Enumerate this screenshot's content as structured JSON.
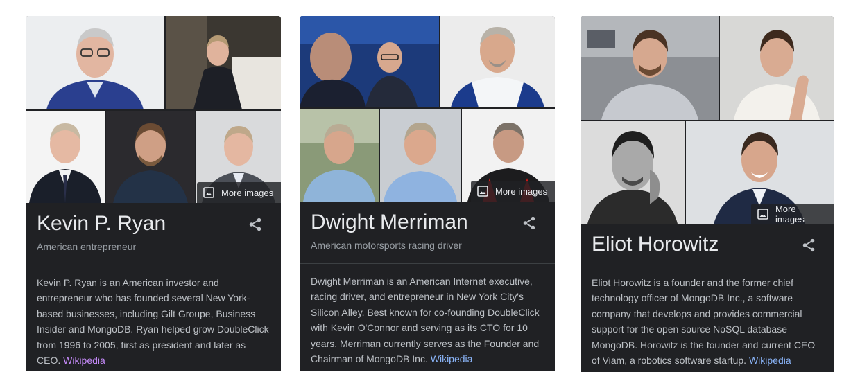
{
  "colors": {
    "card_bg": "#202124",
    "title": "#e8eaed",
    "subtitle": "#9aa0a6",
    "body": "#bdc1c6",
    "link": "#8ab4f8",
    "link_visited": "#c58af9"
  },
  "cards": [
    {
      "name": "Kevin P. Ryan",
      "subtitle": "American entrepreneur",
      "description": "Kevin P. Ryan is an American investor and entrepreneur who has founded several New York-based businesses, including Gilt Groupe, Business Insider and MongoDB. Ryan helped grow DoubleClick from 1996 to 2005, first as president and later as CEO.",
      "link": "Wikipedia",
      "more_images": "More images"
    },
    {
      "name": "Dwight Merriman",
      "subtitle": "American motorsports racing driver",
      "description": "Dwight Merriman is an American Internet executive, racing driver, and entrepreneur in New York City's Silicon Alley. Best known for co-founding DoubleClick with Kevin O'Connor and serving as its CTO for 10 years, Merriman currently serves as the Founder and Chairman of MongoDB Inc.",
      "link": "Wikipedia",
      "more_images": "More images"
    },
    {
      "name": "Eliot Horowitz",
      "subtitle": "",
      "description": "Eliot Horowitz is a founder and the former chief technology officer of MongoDB Inc., a software company that develops and provides commercial support for the open source NoSQL database MongoDB. Horowitz is the founder and current CEO of Viam, a robotics software startup.",
      "link": "Wikipedia",
      "more_images": "More images"
    }
  ]
}
